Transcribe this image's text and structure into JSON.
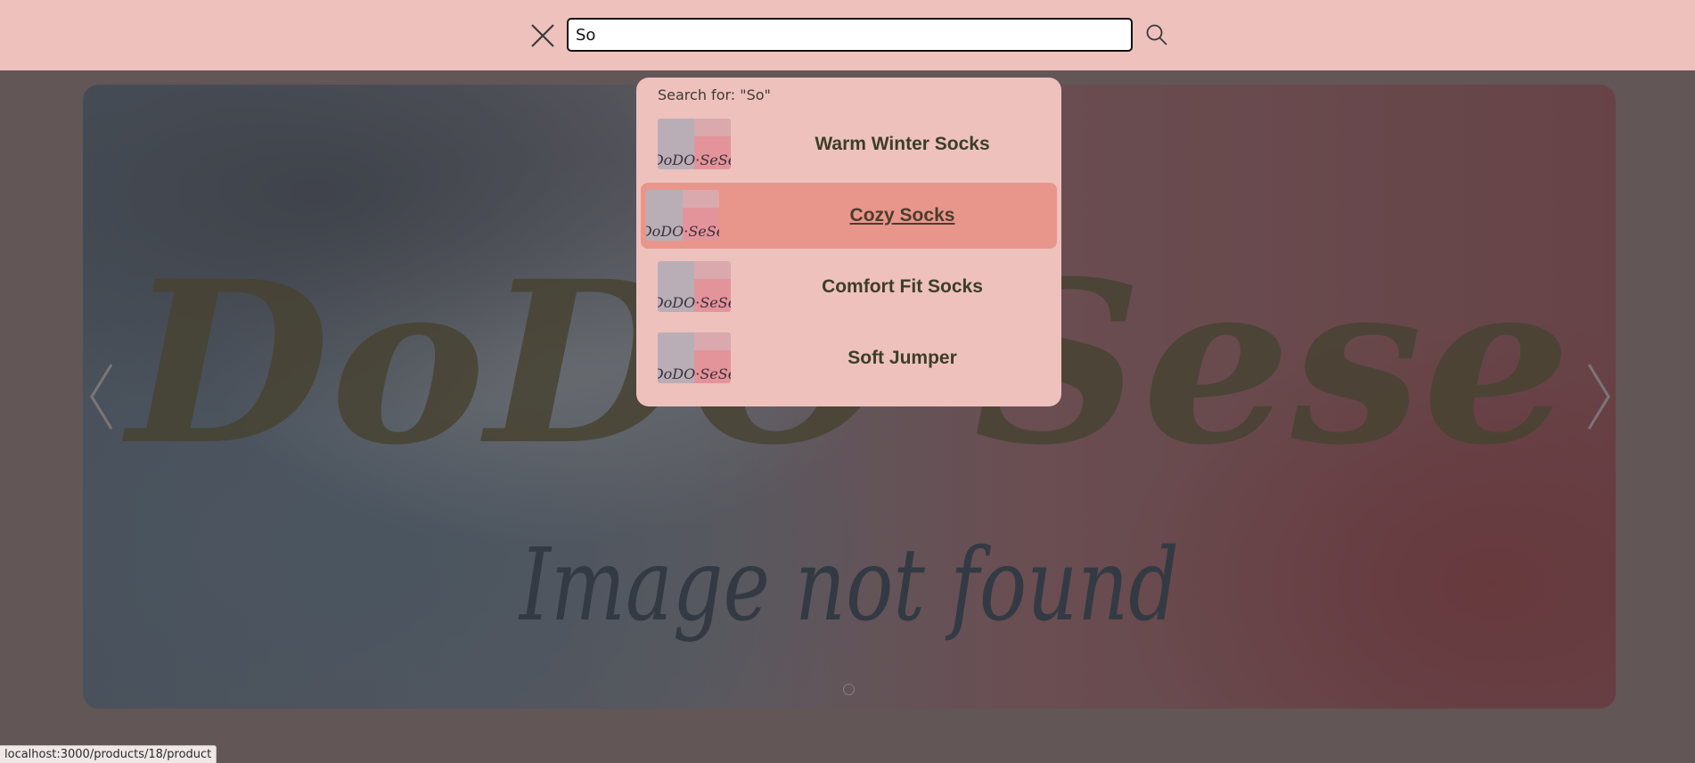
{
  "search": {
    "value": "So",
    "close_icon": "close-icon",
    "search_icon": "search-icon"
  },
  "dropdown": {
    "search_for": "Search for: \"So\"",
    "results": [
      {
        "name": "Warm Winter Socks",
        "active": false
      },
      {
        "name": "Cozy Socks",
        "active": true
      },
      {
        "name": "Comfort Fit Socks",
        "active": false
      },
      {
        "name": "Soft Jumper",
        "active": false
      }
    ]
  },
  "hero": {
    "logo_text": "DoDO’Sese",
    "caption": "Image not found",
    "prev_icon": "chevron-left-icon",
    "next_icon": "chevron-right-icon",
    "slide_count": 1,
    "active_slide": 1
  },
  "status": {
    "url": "localhost:3000/products/18/product"
  },
  "colors": {
    "topbar": "#eec1bd",
    "overlay": "#625657",
    "active_result": "#e8968c",
    "result_text": "#3c3e28"
  }
}
